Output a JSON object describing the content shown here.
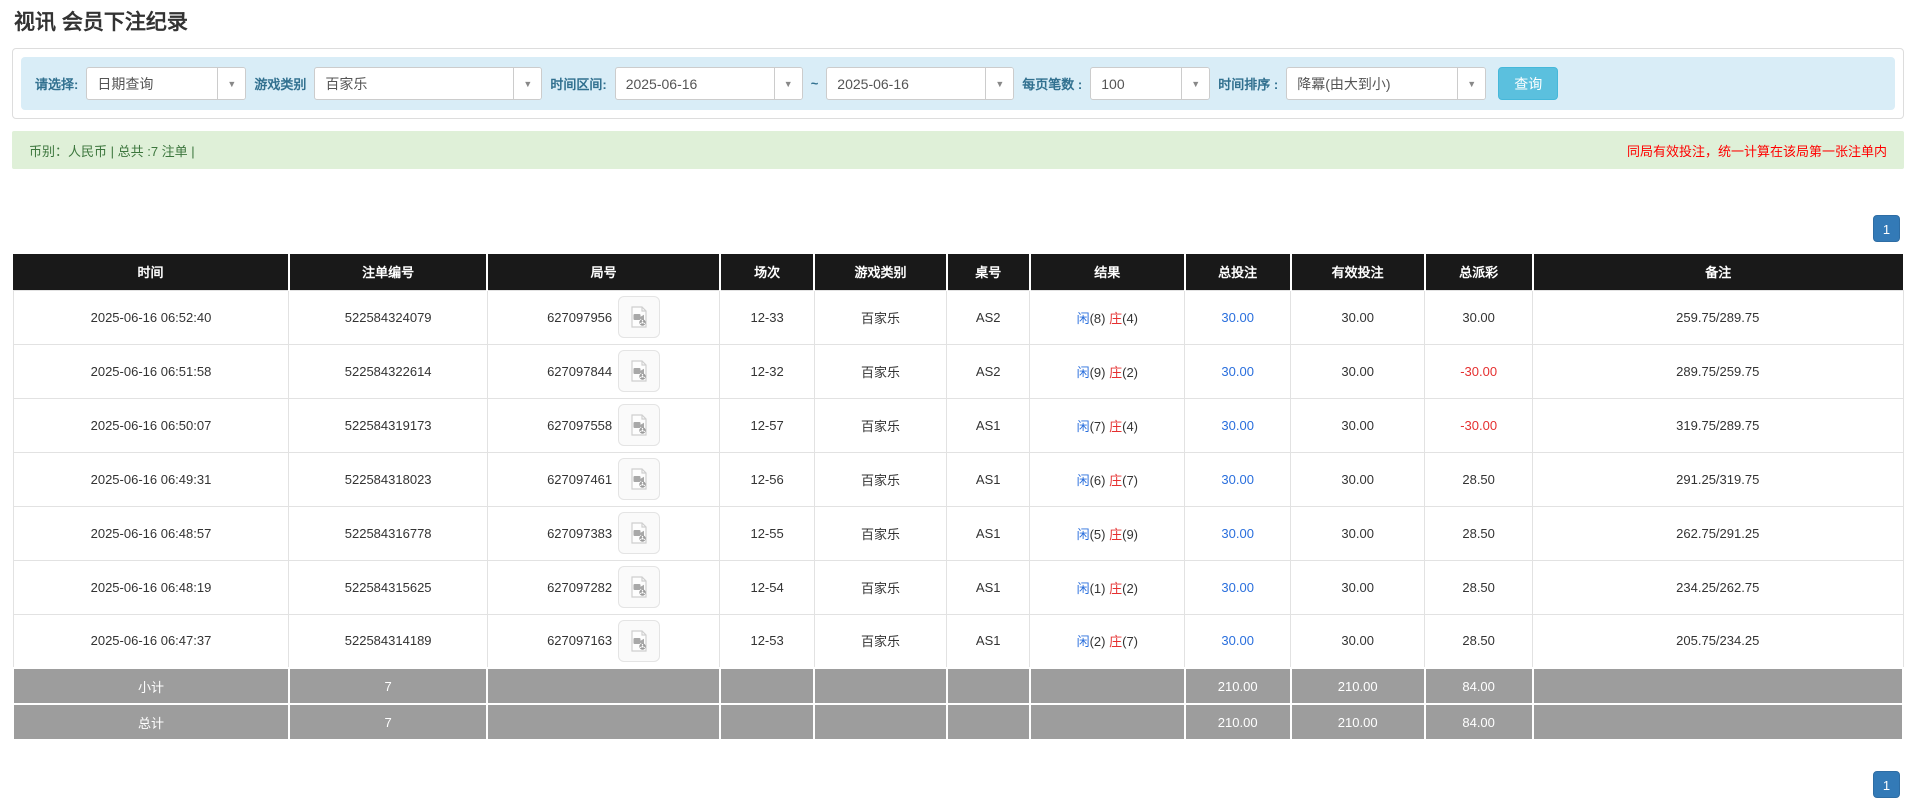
{
  "page": {
    "title": "视讯 会员下注纪录"
  },
  "colors": {
    "header_black": "#191919",
    "filter_bg": "#d9edf7",
    "summary_bg": "#dff0d8",
    "summary_text_green": "#3c763d",
    "notice_red": "#ff0000",
    "highlight_yellow": "#f8f481",
    "footer_gray": "#9d9d9d",
    "link_blue": "#2a6fdd",
    "loss_red": "#e53030",
    "search_btn_blue": "#5bc0de",
    "pager_blue": "#337ab7"
  },
  "filters": {
    "query_type": {
      "label": "请选择:",
      "value": "日期查询"
    },
    "game_category": {
      "label": "游戏类别",
      "value": "百家乐"
    },
    "time_range": {
      "label": "时间区间:",
      "from": "2025-06-16",
      "separator": "~",
      "to": "2025-06-16"
    },
    "page_size": {
      "label": "每页笔数 :",
      "value": "100"
    },
    "time_sort": {
      "label": "时间排序 :",
      "value": "降冪(由大到小)"
    },
    "search_button": "查询",
    "dropdown_arrow": "▼"
  },
  "summary_bar": {
    "left": "币别：人民币 | 总共 :7 注单 |",
    "right": "同局有效投注，统一计算在该局第一张注单内"
  },
  "pagination": {
    "page": "1"
  },
  "table": {
    "headers": [
      "时间",
      "注单编号",
      "局号",
      "场次",
      "游戏类别",
      "桌号",
      "结果",
      "总投注",
      "有效投注",
      "总派彩",
      "备注"
    ],
    "rows": [
      {
        "time": "2025-06-16 06:52:40",
        "bet_id": "522584324079",
        "round_id": "627097956",
        "session": "12-33",
        "game": "百家乐",
        "table_no": "AS2",
        "player_char": "闲",
        "player_num": "(8)",
        "banker_char": "庄",
        "banker_num": "(4)",
        "total_bet": "30.00",
        "valid_bet": "30.00",
        "payout": "30.00",
        "remark": "259.75/289.75",
        "highlight": false
      },
      {
        "time": "2025-06-16 06:51:58",
        "bet_id": "522584322614",
        "round_id": "627097844",
        "session": "12-32",
        "game": "百家乐",
        "table_no": "AS2",
        "player_char": "闲",
        "player_num": "(9)",
        "banker_char": "庄",
        "banker_num": "(2)",
        "total_bet": "30.00",
        "valid_bet": "30.00",
        "payout": "-30.00",
        "remark": "289.75/259.75",
        "highlight": false
      },
      {
        "time": "2025-06-16 06:50:07",
        "bet_id": "522584319173",
        "round_id": "627097558",
        "session": "12-57",
        "game": "百家乐",
        "table_no": "AS1",
        "player_char": "闲",
        "player_num": "(7)",
        "banker_char": "庄",
        "banker_num": "(4)",
        "total_bet": "30.00",
        "valid_bet": "30.00",
        "payout": "-30.00",
        "remark": "319.75/289.75",
        "highlight": true
      },
      {
        "time": "2025-06-16 06:49:31",
        "bet_id": "522584318023",
        "round_id": "627097461",
        "session": "12-56",
        "game": "百家乐",
        "table_no": "AS1",
        "player_char": "闲",
        "player_num": "(6)",
        "banker_char": "庄",
        "banker_num": "(7)",
        "total_bet": "30.00",
        "valid_bet": "30.00",
        "payout": "28.50",
        "remark": "291.25/319.75",
        "highlight": false
      },
      {
        "time": "2025-06-16 06:48:57",
        "bet_id": "522584316778",
        "round_id": "627097383",
        "session": "12-55",
        "game": "百家乐",
        "table_no": "AS1",
        "player_char": "闲",
        "player_num": "(5)",
        "banker_char": "庄",
        "banker_num": "(9)",
        "total_bet": "30.00",
        "valid_bet": "30.00",
        "payout": "28.50",
        "remark": "262.75/291.25",
        "highlight": false
      },
      {
        "time": "2025-06-16 06:48:19",
        "bet_id": "522584315625",
        "round_id": "627097282",
        "session": "12-54",
        "game": "百家乐",
        "table_no": "AS1",
        "player_char": "闲",
        "player_num": "(1)",
        "banker_char": "庄",
        "banker_num": "(2)",
        "total_bet": "30.00",
        "valid_bet": "30.00",
        "payout": "28.50",
        "remark": "234.25/262.75",
        "highlight": false
      },
      {
        "time": "2025-06-16 06:47:37",
        "bet_id": "522584314189",
        "round_id": "627097163",
        "session": "12-53",
        "game": "百家乐",
        "table_no": "AS1",
        "player_char": "闲",
        "player_num": "(2)",
        "banker_char": "庄",
        "banker_num": "(7)",
        "total_bet": "30.00",
        "valid_bet": "30.00",
        "payout": "28.50",
        "remark": "205.75/234.25",
        "highlight": false
      }
    ],
    "subtotal": {
      "label": "小计",
      "count": "7",
      "total_bet": "210.00",
      "valid_bet": "210.00",
      "payout": "84.00"
    },
    "total": {
      "label": "总计",
      "count": "7",
      "total_bet": "210.00",
      "valid_bet": "210.00",
      "payout": "84.00"
    }
  }
}
